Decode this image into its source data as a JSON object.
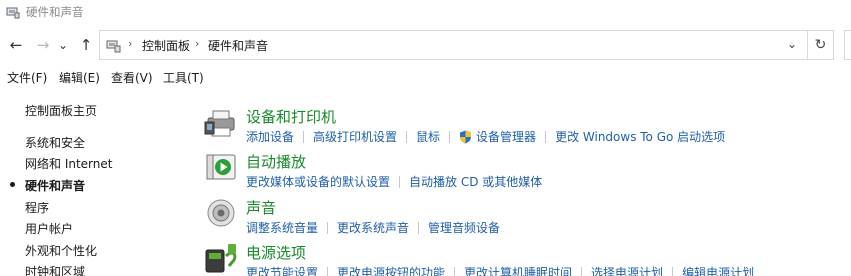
{
  "window": {
    "title": "硬件和声音",
    "icon": "control-panel-icon"
  },
  "nav": {
    "back": "←",
    "forward": "→",
    "recent": "⌄",
    "up": "↑",
    "breadcrumbs": [
      "控制面板",
      "硬件和声音"
    ],
    "separator": "›",
    "dropdown": "⌄",
    "refresh": "↻"
  },
  "menubar": [
    "文件(F)",
    "编辑(E)",
    "查看(V)",
    "工具(T)"
  ],
  "sidebar": {
    "items": [
      {
        "label": "控制面板主页"
      },
      {
        "label": "系统和安全"
      },
      {
        "label": "网络和 Internet"
      },
      {
        "label": "硬件和声音",
        "current": true
      },
      {
        "label": "程序"
      },
      {
        "label": "用户帐户"
      },
      {
        "label": "外观和个性化"
      },
      {
        "label": "时钟和区域"
      }
    ]
  },
  "categories": [
    {
      "title": "设备和打印机",
      "icon": "printer-icon",
      "links": [
        "添加设备",
        "高级打印机设置",
        "鼠标",
        "设备管理器",
        "更改 Windows To Go 启动选项"
      ],
      "shield_on": "设备管理器"
    },
    {
      "title": "自动播放",
      "icon": "autoplay-icon",
      "links": [
        "更改媒体或设备的默认设置",
        "自动播放 CD 或其他媒体"
      ]
    },
    {
      "title": "声音",
      "icon": "speaker-icon",
      "links": [
        "调整系统音量",
        "更改系统声音",
        "管理音频设备"
      ]
    },
    {
      "title": "电源选项",
      "icon": "power-icon",
      "links": [
        "更改节能设置",
        "更改电源按钮的功能",
        "更改计算机睡眠时间",
        "选择电源计划",
        "编辑电源计划"
      ]
    }
  ],
  "colors": {
    "category_title": "#1a8a2a",
    "link": "#1f5fa8",
    "text": "#1a1a1a"
  }
}
